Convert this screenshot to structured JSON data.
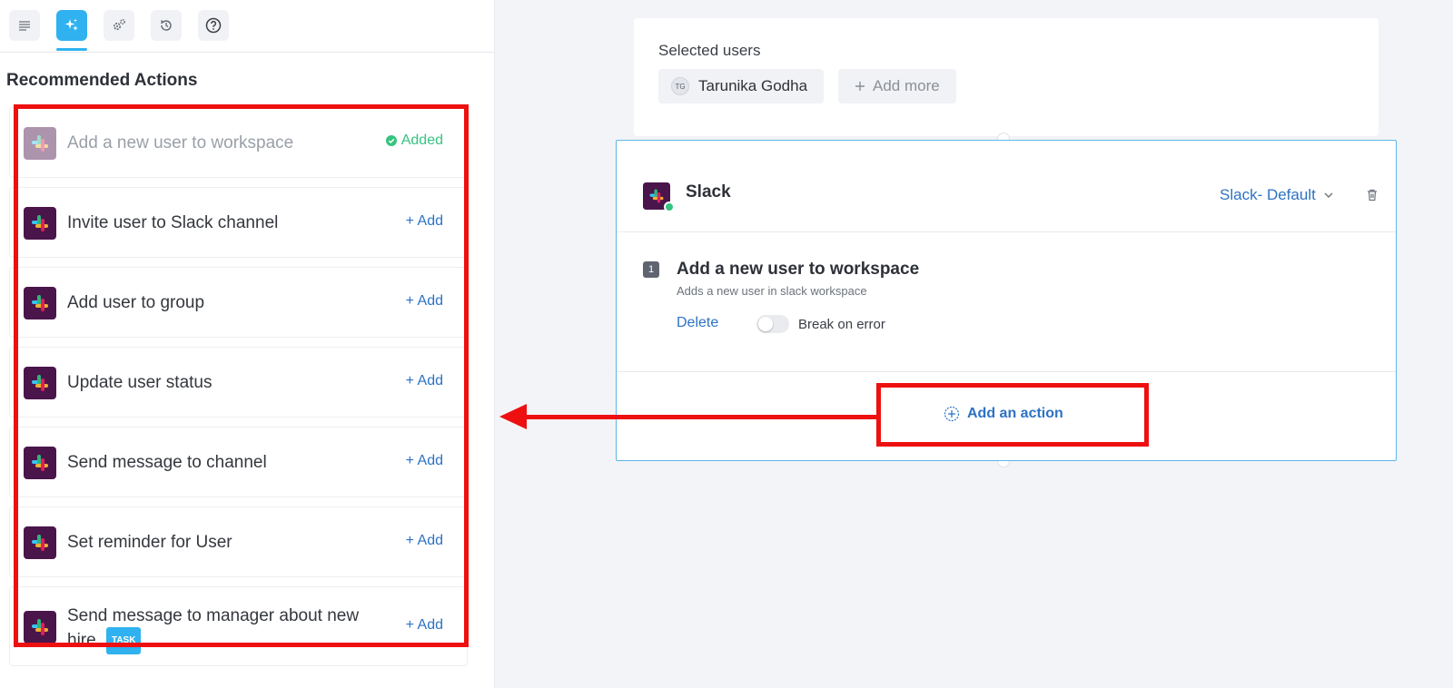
{
  "sidebar": {
    "toolbar": [
      {
        "icon": "details-icon"
      },
      {
        "icon": "sparkle-icon",
        "active": true
      },
      {
        "icon": "settings-icon"
      },
      {
        "icon": "history-icon"
      },
      {
        "icon": "help-icon"
      }
    ],
    "section_title": "Recommended Actions",
    "actions": [
      {
        "label": "Add a new user to workspace",
        "status": "Added"
      },
      {
        "label": "Invite user to Slack channel",
        "add_label": "+ Add"
      },
      {
        "label": "Add user to group",
        "add_label": "+ Add"
      },
      {
        "label": "Update user status",
        "add_label": "+ Add"
      },
      {
        "label": "Send message to channel",
        "add_label": "+ Add"
      },
      {
        "label": "Set reminder for User",
        "add_label": "+ Add"
      },
      {
        "label": "Send message to manager about new hire.",
        "badge": "TASK",
        "add_label": "+ Add"
      }
    ]
  },
  "users": {
    "title": "Selected users",
    "selected": [
      {
        "initials": "TG",
        "name": "Tarunika Godha"
      }
    ],
    "add_more_label": "Add more"
  },
  "slack_card": {
    "app_name": "Slack",
    "connection": "Slack- Default",
    "steps": [
      {
        "number": "1",
        "title": "Add a new user to workspace",
        "description": "Adds a new user in slack workspace",
        "delete_label": "Delete",
        "break_on_error_label": "Break on error",
        "break_on_error": false
      }
    ],
    "add_action_label": "Add an action"
  },
  "colors": {
    "accent": "#2fb2ef",
    "link": "#2d72c4",
    "success": "#35c47f",
    "annotation": "#ee1010",
    "canvas_bg": "#f3f4f8"
  }
}
